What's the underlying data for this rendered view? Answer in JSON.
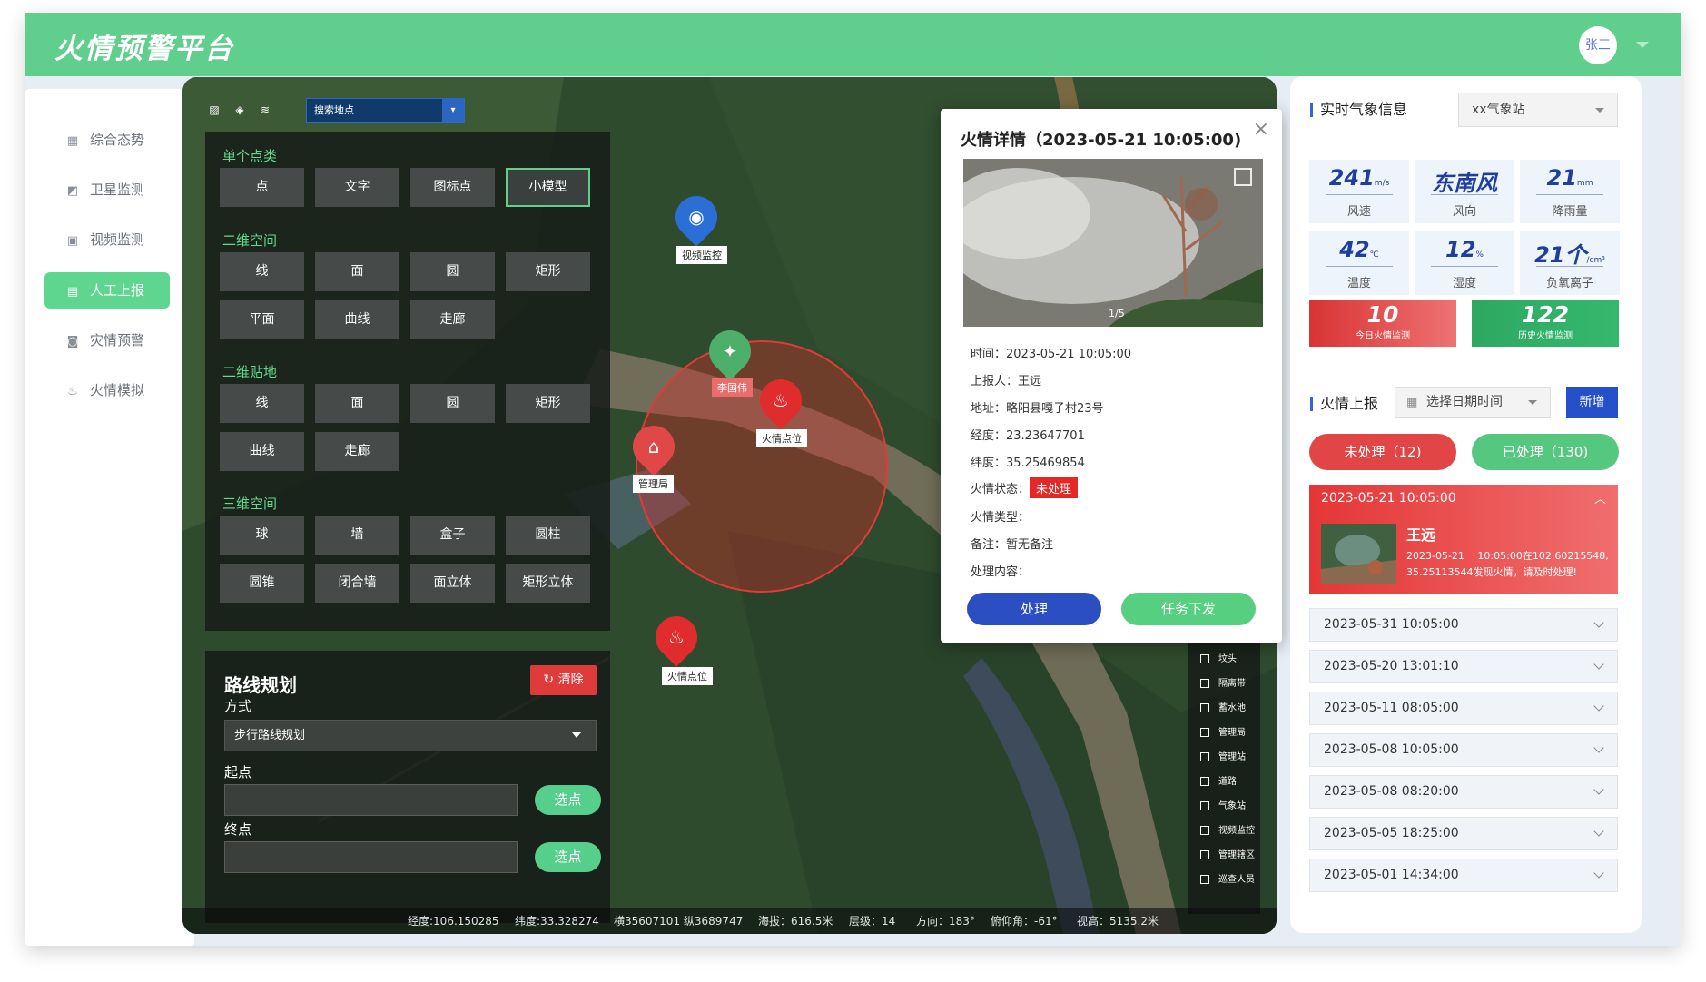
{
  "header": {
    "title": "火情预警平台",
    "user": "张三"
  },
  "sidebar": {
    "items": [
      {
        "label": "综合态势",
        "icon": "dashboard-icon"
      },
      {
        "label": "卫星监测",
        "icon": "satellite-icon"
      },
      {
        "label": "视频监测",
        "icon": "video-icon"
      },
      {
        "label": "人工上报",
        "icon": "report-icon",
        "active": true
      },
      {
        "label": "灾情预警",
        "icon": "alert-icon"
      },
      {
        "label": "火情模拟",
        "icon": "fire-icon"
      }
    ]
  },
  "map": {
    "search_placeholder": "搜索地点",
    "tools": {
      "single_point": {
        "title": "单个点类",
        "buttons": [
          "点",
          "文字",
          "图标点",
          "小模型"
        ],
        "selected": "小模型"
      },
      "space_2d": {
        "title": "二维空间",
        "buttons": [
          "线",
          "面",
          "圆",
          "矩形",
          "平面",
          "曲线",
          "走廊"
        ]
      },
      "ground_2d": {
        "title": "二维贴地",
        "buttons": [
          "线",
          "面",
          "圆",
          "矩形",
          "曲线",
          "走廊"
        ]
      },
      "space_3d": {
        "title": "三维空间",
        "buttons": [
          "球",
          "墙",
          "盒子",
          "圆柱",
          "圆锥",
          "闭合墙",
          "面立体",
          "矩形立体"
        ]
      }
    },
    "route": {
      "title": "路线规划",
      "clear_label": "清除",
      "mode_label": "方式",
      "mode_value": "步行路线规划",
      "start_label": "起点",
      "end_label": "终点",
      "pick_label": "选点"
    },
    "markers": {
      "video": "视频监控",
      "person": "李国伟",
      "fire1": "火情点位",
      "fire2": "火情点位",
      "station": "管理局"
    },
    "legend": [
      "坟头",
      "隔离带",
      "蓄水池",
      "管理局",
      "管理站",
      "道路",
      "气象站",
      "视频监控",
      "管理辖区",
      "巡查人员"
    ],
    "status": {
      "lon": "经度:106.150285",
      "lat": "纬度:33.328274",
      "xy": "横35607101 纵3689747",
      "alt": "海拔：616.5米",
      "level": "层级：14",
      "heading": "方向：183°",
      "pitch": "俯仰角：-61°",
      "height": "视高：5135.2米"
    }
  },
  "popup": {
    "title": "火情详情（2023-05-21 10:05:00)",
    "counter": "1/5",
    "time": "时间：2023-05-21 10:05:00",
    "reporter": "上报人：王远",
    "address": "地址：略阳县嘎子村23号",
    "lon": "经度：23.23647701",
    "lat": "纬度：35.25469854",
    "status_label": "火情状态：",
    "status_value": "未处理",
    "type": "火情类型：",
    "note": "备注：暂无备注",
    "content": "处理内容：",
    "handle_label": "处理",
    "task_label": "任务下发"
  },
  "weather": {
    "title": "实时气象信息",
    "station": "xx气象站",
    "cards": [
      {
        "value": "241",
        "unit": "m/s",
        "label": "风速"
      },
      {
        "value": "东南风",
        "unit": "",
        "label": "风向"
      },
      {
        "value": "21",
        "unit": "mm",
        "label": "降雨量"
      },
      {
        "value": "42",
        "unit": "℃",
        "label": "温度"
      },
      {
        "value": "12",
        "unit": "%",
        "label": "湿度"
      },
      {
        "value": "21个",
        "unit": "/cm³",
        "label": "负氧离子"
      }
    ],
    "today": {
      "value": "10",
      "label": "今日火情监测"
    },
    "history": {
      "value": "122",
      "label": "历史火情监测"
    }
  },
  "reports": {
    "title": "火情上报",
    "date_placeholder": "选择日期时间",
    "add_label": "新增",
    "tab_pending": "未处理（12)",
    "tab_done": "已处理（130)",
    "open": {
      "time": "2023-05-21 10:05:00",
      "name": "王远",
      "desc": "2023-05-21　 10:05:00在102.60215548, 35.25113544发现火情，请及时处理!"
    },
    "items": [
      "2023-05-31 10:05:00",
      "2023-05-20 13:01:10",
      "2023-05-11 08:05:00",
      "2023-05-08 10:05:00",
      "2023-05-08 08:20:00",
      "2023-05-05 18:25:00",
      "2023-05-01 14:34:00"
    ]
  }
}
